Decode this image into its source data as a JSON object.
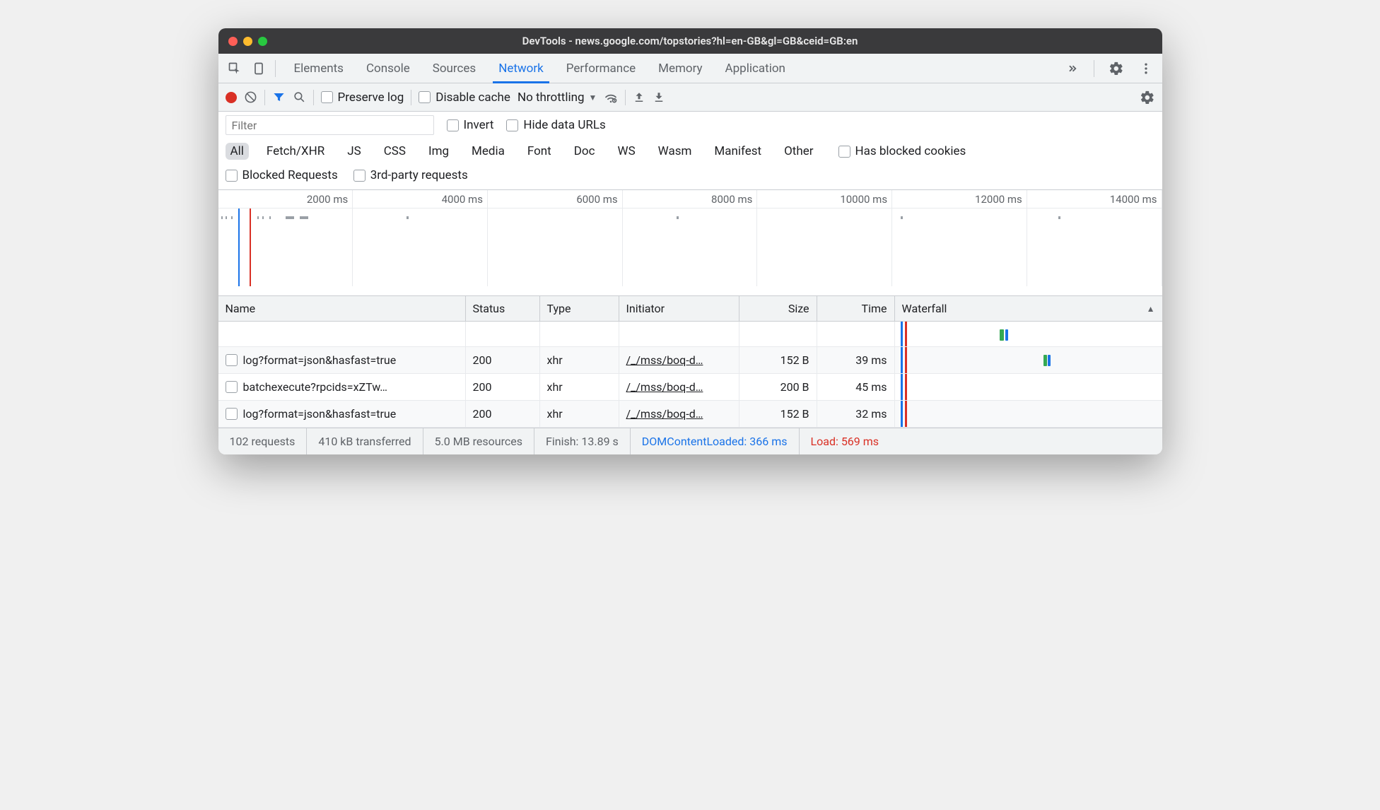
{
  "window": {
    "title": "DevTools - news.google.com/topstories?hl=en-GB&gl=GB&ceid=GB:en"
  },
  "tabs": {
    "items": [
      "Elements",
      "Console",
      "Sources",
      "Network",
      "Performance",
      "Memory",
      "Application"
    ],
    "active": "Network"
  },
  "toolbar": {
    "preserve_log": "Preserve log",
    "disable_cache": "Disable cache",
    "throttling": "No throttling"
  },
  "filter": {
    "placeholder": "Filter",
    "invert": "Invert",
    "hide_data_urls": "Hide data URLs"
  },
  "types": [
    "All",
    "Fetch/XHR",
    "JS",
    "CSS",
    "Img",
    "Media",
    "Font",
    "Doc",
    "WS",
    "Wasm",
    "Manifest",
    "Other"
  ],
  "types_active": "All",
  "extras": {
    "has_blocked_cookies": "Has blocked cookies",
    "blocked_requests": "Blocked Requests",
    "third_party": "3rd-party requests"
  },
  "timeline": {
    "ticks": [
      "2000 ms",
      "4000 ms",
      "6000 ms",
      "8000 ms",
      "10000 ms",
      "12000 ms",
      "14000 ms"
    ]
  },
  "columns": {
    "name": "Name",
    "status": "Status",
    "type": "Type",
    "initiator": "Initiator",
    "size": "Size",
    "time": "Time",
    "waterfall": "Waterfall"
  },
  "rows": [
    {
      "name": "log?format=json&hasfast=true",
      "status": "200",
      "type": "xhr",
      "initiator": "/_/mss/boq-d…",
      "size": "152 B",
      "time": "39 ms"
    },
    {
      "name": "batchexecute?rpcids=xZTw…",
      "status": "200",
      "type": "xhr",
      "initiator": "/_/mss/boq-d…",
      "size": "200 B",
      "time": "45 ms"
    },
    {
      "name": "log?format=json&hasfast=true",
      "status": "200",
      "type": "xhr",
      "initiator": "/_/mss/boq-d…",
      "size": "152 B",
      "time": "32 ms"
    }
  ],
  "footer": {
    "requests": "102 requests",
    "transferred": "410 kB transferred",
    "resources": "5.0 MB resources",
    "finish": "Finish: 13.89 s",
    "dcl": "DOMContentLoaded: 366 ms",
    "load": "Load: 569 ms"
  }
}
